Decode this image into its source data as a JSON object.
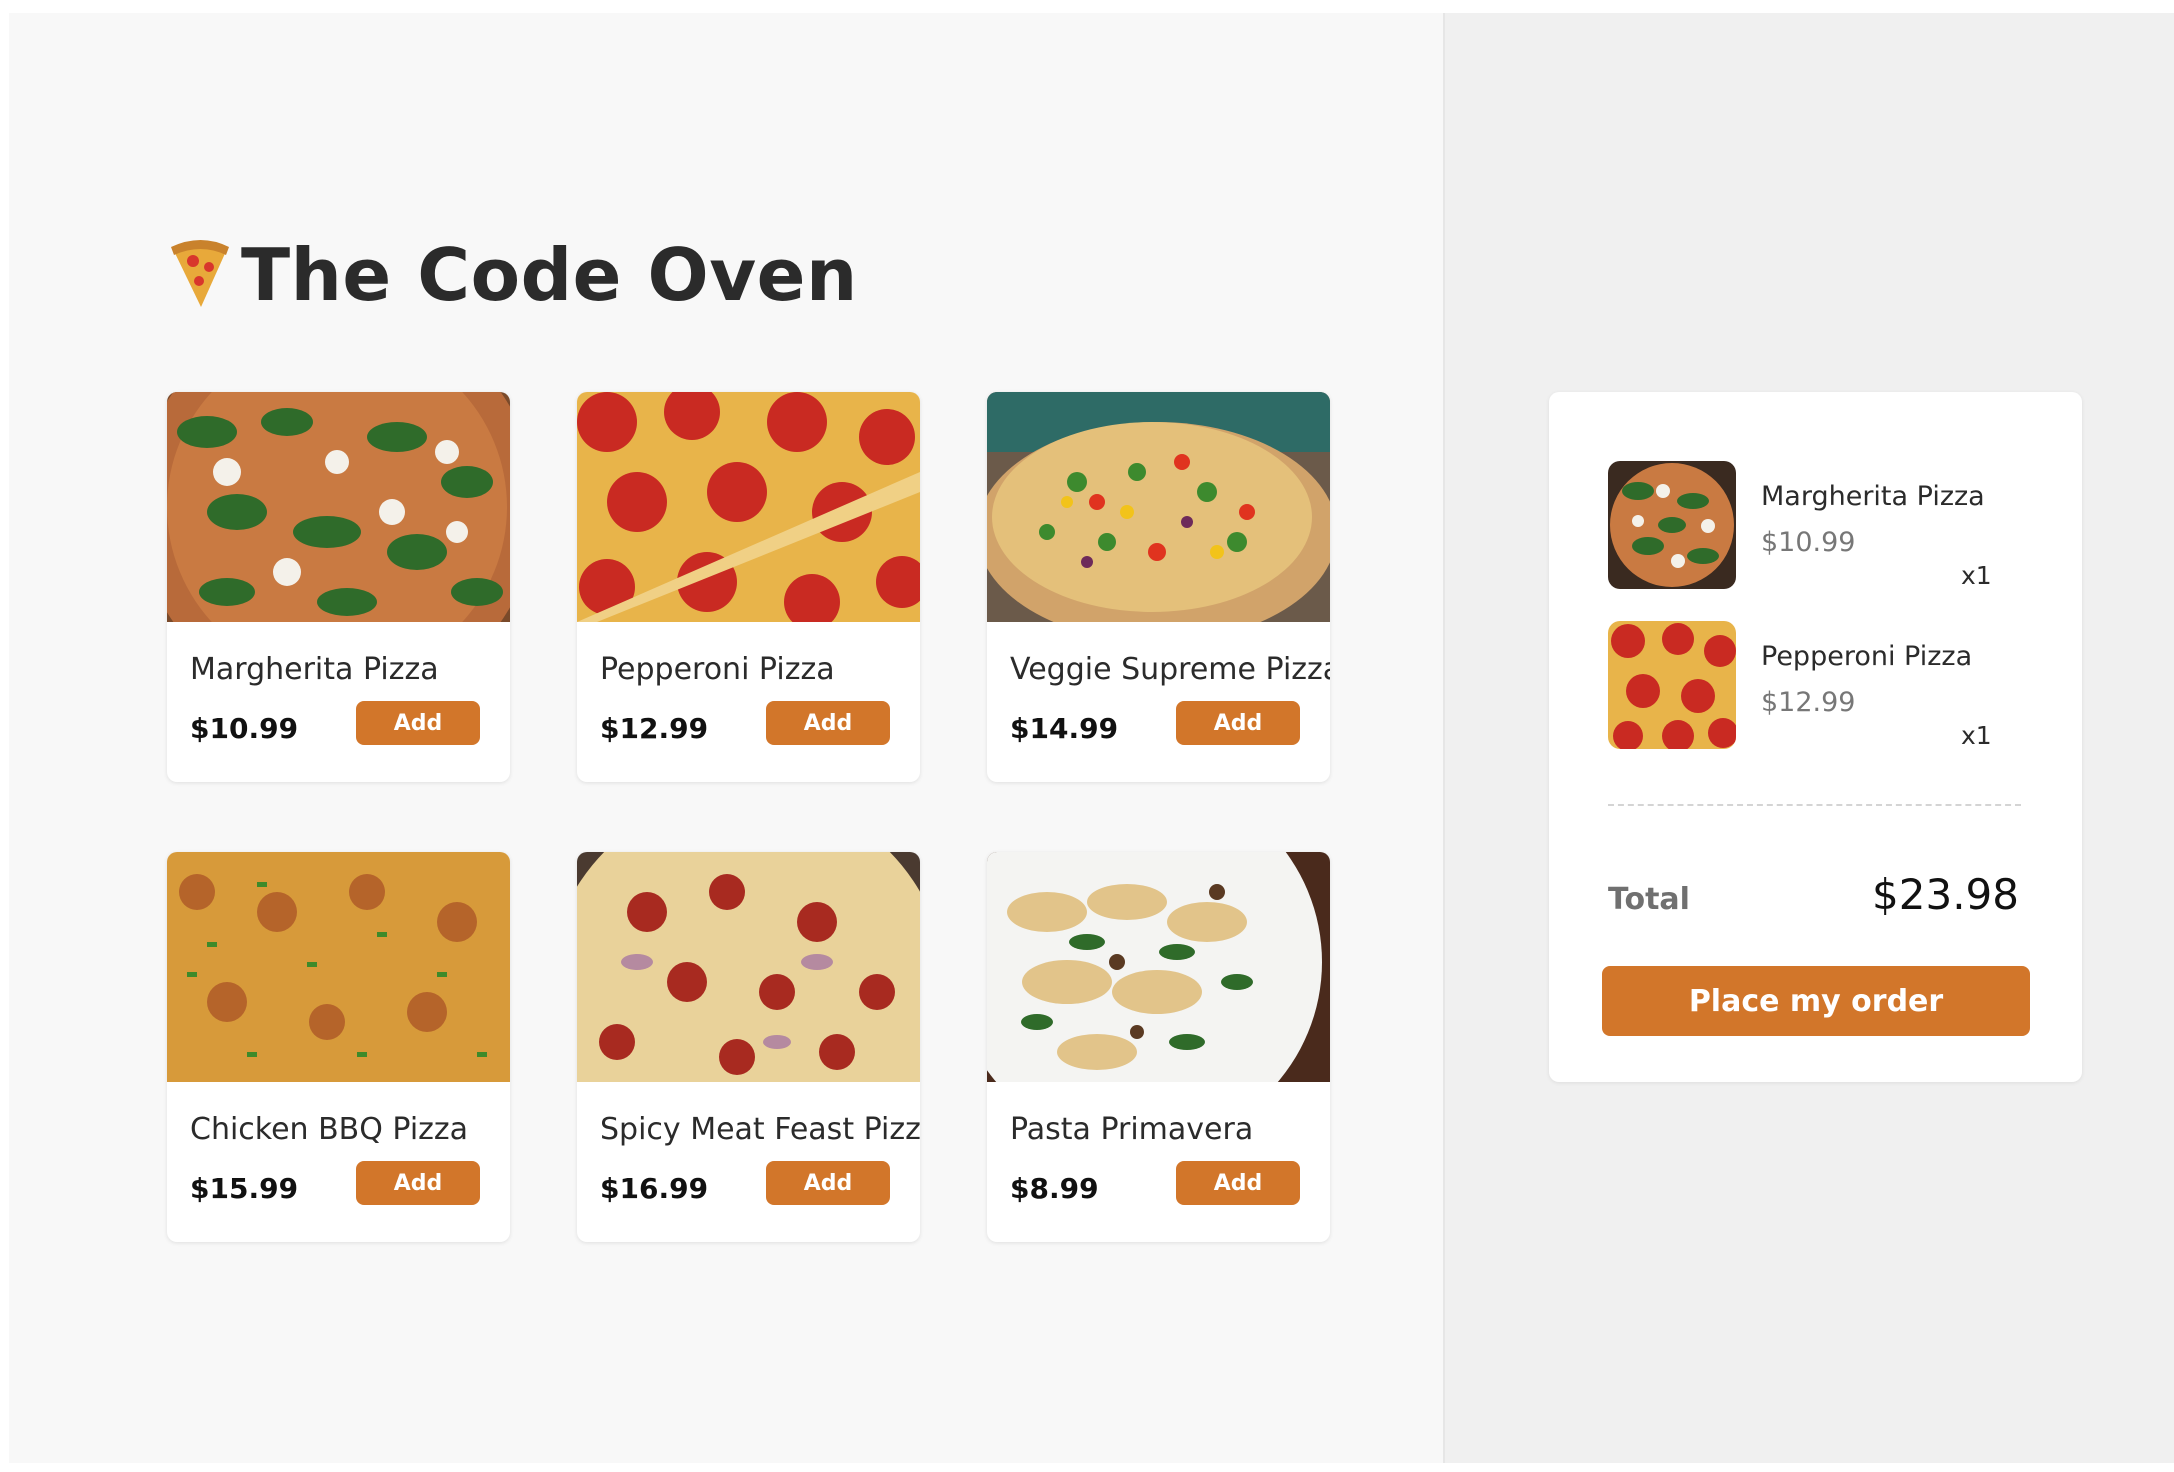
{
  "app": {
    "title": "The Code Oven",
    "accent": "#d2762a"
  },
  "menu": {
    "add_label": "Add",
    "items": [
      {
        "name": "Margherita Pizza",
        "price": "$10.99",
        "image": "margherita-pizza-photo"
      },
      {
        "name": "Pepperoni Pizza",
        "price": "$12.99",
        "image": "pepperoni-pizza-photo"
      },
      {
        "name": "Veggie Supreme Pizza",
        "price": "$14.99",
        "image": "veggie-pizza-photo"
      },
      {
        "name": "Chicken BBQ Pizza",
        "price": "$15.99",
        "image": "chicken-bbq-pizza-photo"
      },
      {
        "name": "Spicy Meat Feast Pizza",
        "price": "$16.99",
        "image": "meat-feast-pizza-photo"
      },
      {
        "name": "Pasta Primavera",
        "price": "$8.99",
        "image": "pasta-primavera-photo"
      }
    ]
  },
  "cart": {
    "items": [
      {
        "name": "Margherita Pizza",
        "price": "$10.99",
        "qty": "x1"
      },
      {
        "name": "Pepperoni Pizza",
        "price": "$12.99",
        "qty": "x1"
      }
    ],
    "total_label": "Total",
    "total_value": "$23.98",
    "order_label": "Place my order"
  }
}
